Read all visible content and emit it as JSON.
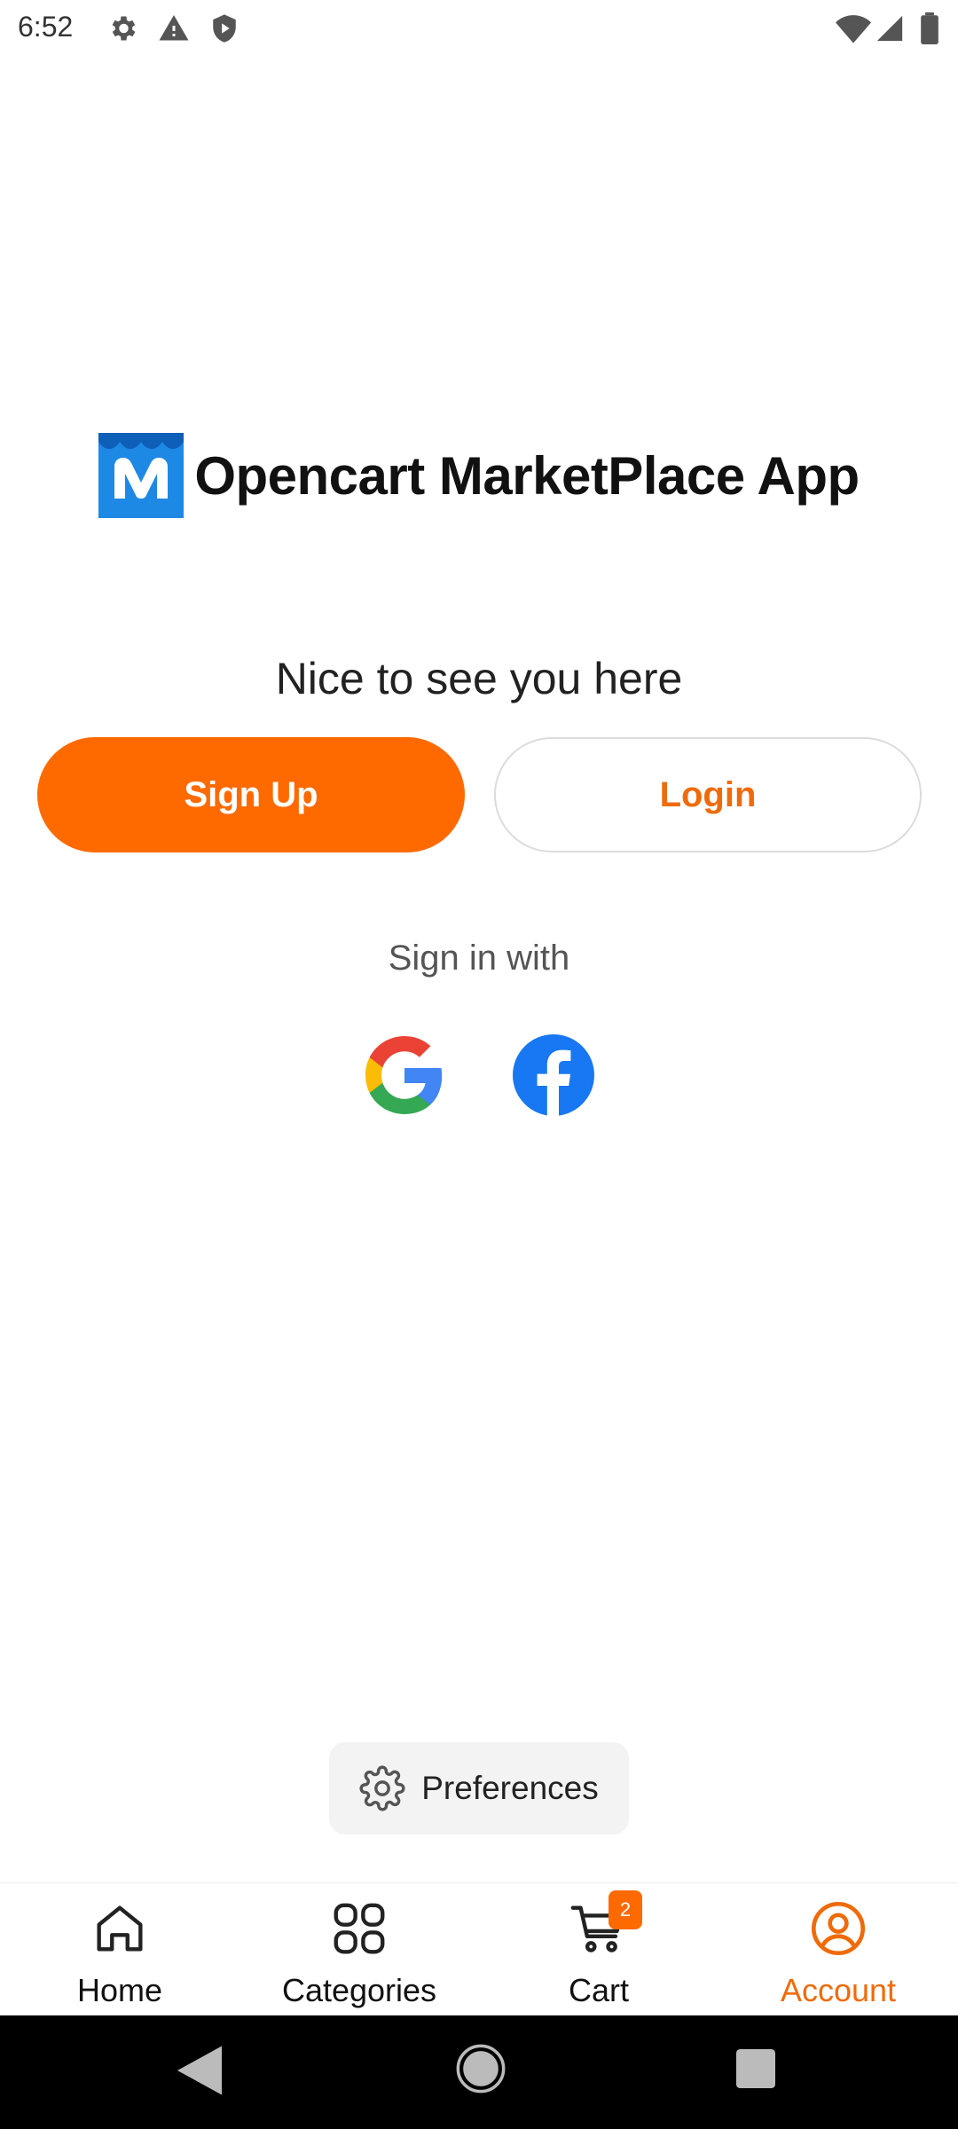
{
  "status_bar": {
    "time": "6:52",
    "left_icons": [
      "gear-icon",
      "warning-icon",
      "shield-icon"
    ],
    "right_icons": [
      "wifi-icon",
      "signal-icon",
      "battery-icon"
    ]
  },
  "brand": {
    "title": "Opencart MarketPlace App",
    "logo_color": "#1e88e5"
  },
  "welcome": {
    "heading": "Nice to see you here",
    "signup_label": "Sign Up",
    "login_label": "Login",
    "signin_with": "Sign in with",
    "social": [
      "google-icon",
      "facebook-icon"
    ]
  },
  "preferences": {
    "label": "Preferences"
  },
  "bottom_nav": {
    "items": [
      {
        "label": "Home",
        "icon": "home-icon"
      },
      {
        "label": "Categories",
        "icon": "grid-icon"
      },
      {
        "label": "Cart",
        "icon": "cart-icon",
        "badge": "2"
      },
      {
        "label": "Account",
        "icon": "account-icon",
        "active": true
      }
    ]
  },
  "colors": {
    "accent": "#ff6a00",
    "accent_text": "#ef6b0a",
    "facebook": "#1877f2"
  }
}
